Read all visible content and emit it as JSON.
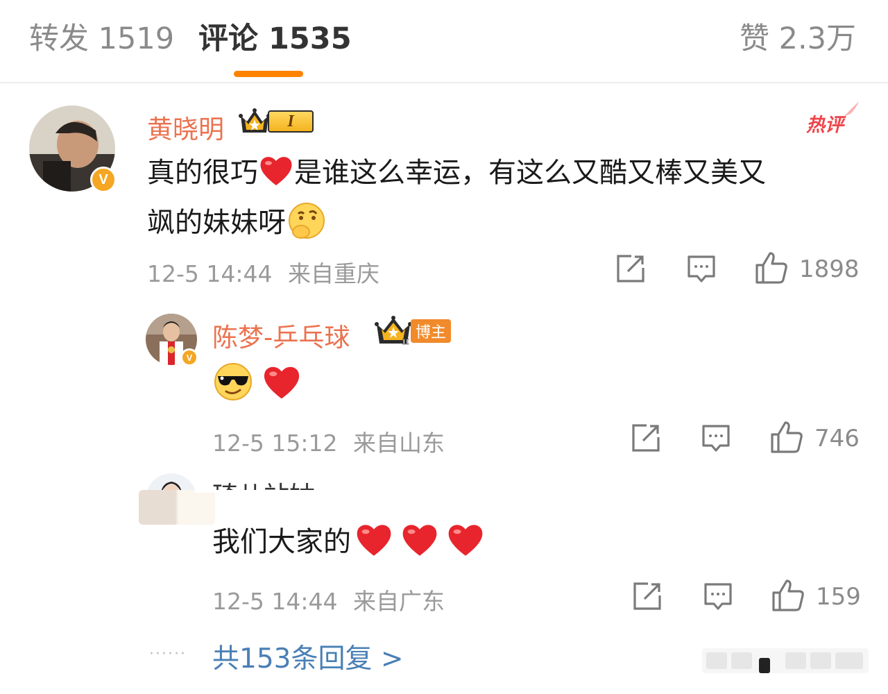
{
  "tabs": {
    "repost": "转发 1519",
    "comment": "评论 1535",
    "like": "赞 2.3万"
  },
  "colors": {
    "accent": "#ff8200",
    "username": "#eb7350",
    "link": "#4a7fb5",
    "hot": "#f0444a"
  },
  "comment": {
    "author": "黄晓明",
    "level": "I",
    "hot_label": "热评",
    "text_line1": "真的很巧",
    "text_line1b": "是谁这么幸运，有这么又酷又棒又美又",
    "text_line2": "飒的妹妹呀",
    "emoji_icons": [
      "heart-icon",
      "thinking-face-icon"
    ],
    "date": "12-5 14:44",
    "location": "来自重庆",
    "like_count": "1898"
  },
  "replies": [
    {
      "author": "陈梦-乒乓球",
      "author_tag": "博主",
      "level": "II",
      "emoji_icons": [
        "sunglasses-face-icon",
        "heart-icon"
      ],
      "date": "12-5 15:12",
      "location": "来自山东",
      "like_count": "746"
    },
    {
      "author": "琦儿站姑",
      "text": "我们大家的",
      "emoji_icons": [
        "heart-icon",
        "heart-icon",
        "heart-icon"
      ],
      "date": "12-5 14:44",
      "location": "来自广东",
      "like_count": "159"
    }
  ],
  "more_replies": {
    "dots": "······",
    "label": "共153条回复 >"
  }
}
